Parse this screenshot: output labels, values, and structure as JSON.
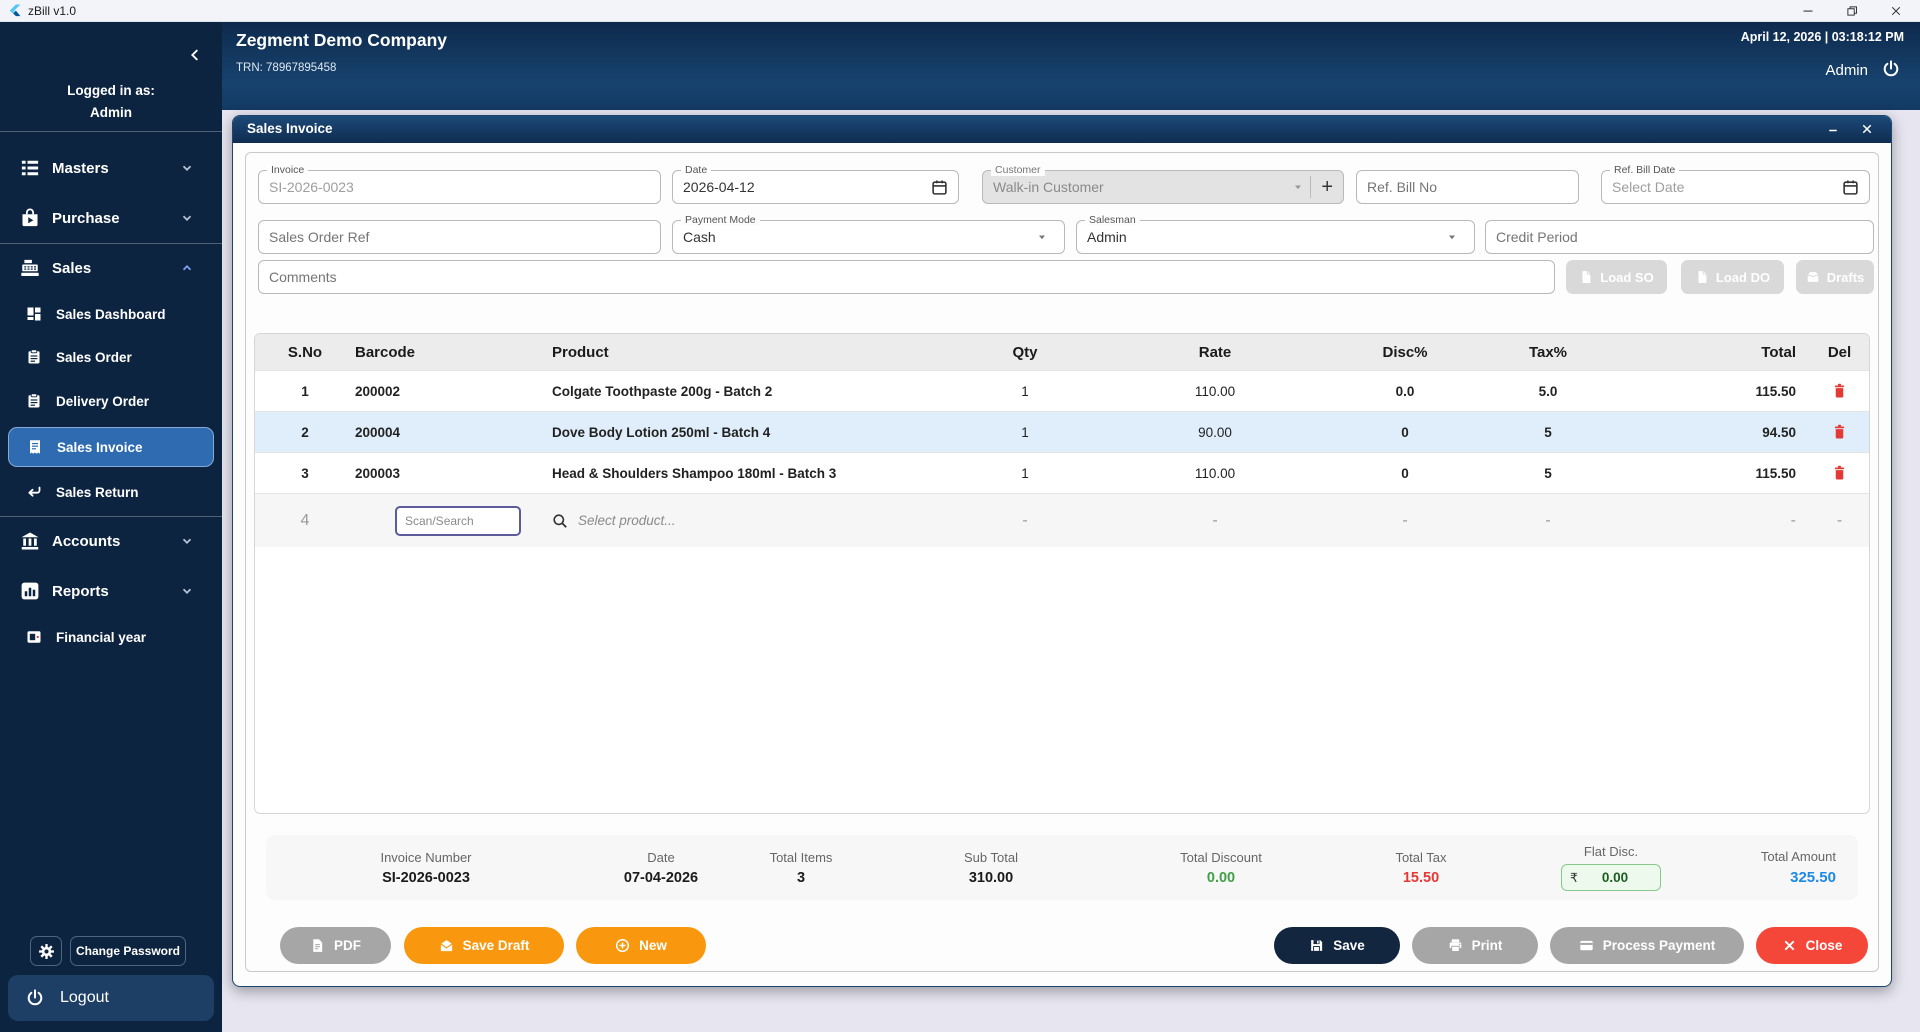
{
  "titlebar": {
    "app_title": "zBill v1.0"
  },
  "header": {
    "company": "Zegment Demo Company",
    "trn": "TRN: 78967895458",
    "datetime": "April 12, 2026 | 03:18:12 PM",
    "user": "Admin"
  },
  "sidebar": {
    "logged_in_label": "Logged in as:",
    "logged_in_user": "Admin",
    "menu": {
      "masters": "Masters",
      "purchase": "Purchase",
      "sales": "Sales",
      "sales_dashboard": "Sales Dashboard",
      "sales_order": "Sales Order",
      "delivery_order": "Delivery Order",
      "sales_invoice": "Sales Invoice",
      "sales_return": "Sales Return",
      "accounts": "Accounts",
      "reports": "Reports",
      "financial_year": "Financial year"
    },
    "change_password": "Change Password",
    "logout": "Logout"
  },
  "invoice_window": {
    "title": "Sales Invoice",
    "fields": {
      "invoice": {
        "label": "Invoice",
        "value": "SI-2026-0023"
      },
      "date": {
        "label": "Date",
        "value": "2026-04-12"
      },
      "customer": {
        "label": "Customer",
        "value": "Walk-in Customer",
        "add_symbol": "+"
      },
      "ref_bill_no": {
        "placeholder": "Ref. Bill No"
      },
      "ref_bill_date": {
        "label": "Ref. Bill Date",
        "placeholder": "Select Date"
      },
      "sales_order_ref": {
        "placeholder": "Sales Order Ref"
      },
      "payment_mode": {
        "label": "Payment Mode",
        "value": "Cash"
      },
      "salesman": {
        "label": "Salesman",
        "value": "Admin"
      },
      "credit_period": {
        "placeholder": "Credit Period"
      },
      "comments": {
        "placeholder": "Comments"
      }
    },
    "actions": {
      "load_so": "Load SO",
      "load_do": "Load DO",
      "drafts": "Drafts"
    },
    "table": {
      "headers": [
        "S.No",
        "Barcode",
        "Product",
        "Qty",
        "Rate",
        "Disc%",
        "Tax%",
        "Total",
        "Del"
      ],
      "rows": [
        {
          "sno": "1",
          "barcode": "200002",
          "product": "Colgate Toothpaste 200g - Batch 2",
          "qty": "1",
          "rate": "110.00",
          "disc": "0.0",
          "tax": "5.0",
          "total": "115.50"
        },
        {
          "sno": "2",
          "barcode": "200004",
          "product": "Dove Body Lotion 250ml - Batch 4",
          "qty": "1",
          "rate": "90.00",
          "disc": "0",
          "tax": "5",
          "total": "94.50"
        },
        {
          "sno": "3",
          "barcode": "200003",
          "product": "Head & Shoulders Shampoo 180ml - Batch 3",
          "qty": "1",
          "rate": "110.00",
          "disc": "0",
          "tax": "5",
          "total": "115.50"
        }
      ],
      "entry_row": {
        "sno": "4",
        "scan_placeholder": "Scan/Search",
        "select_placeholder": "Select product...",
        "empty": "-"
      }
    },
    "summary": {
      "invoice_number": {
        "label": "Invoice Number",
        "value": "SI-2026-0023"
      },
      "date": {
        "label": "Date",
        "value": "07-04-2026"
      },
      "total_items": {
        "label": "Total Items",
        "value": "3"
      },
      "sub_total": {
        "label": "Sub Total",
        "value": "310.00"
      },
      "total_discount": {
        "label": "Total Discount",
        "value": "0.00"
      },
      "total_tax": {
        "label": "Total Tax",
        "value": "15.50"
      },
      "flat_disc": {
        "label": "Flat Disc.",
        "currency": "₹",
        "value": "0.00"
      },
      "total_amount": {
        "label": "Total Amount",
        "value": "325.50"
      }
    },
    "buttons": {
      "pdf": "PDF",
      "save_draft": "Save Draft",
      "new": "New",
      "save": "Save",
      "print": "Print",
      "process_payment": "Process Payment",
      "close": "Close"
    }
  },
  "icons": {
    "titlebar": [
      "flutter-logo",
      "minimize-icon",
      "restore-icon",
      "close-icon"
    ],
    "header": [
      "power-icon"
    ],
    "sidebar": [
      "chevron-left-icon",
      "list-icon",
      "purchase-bag-icon",
      "cash-register-icon",
      "dashboard-icon",
      "clipboard-icon",
      "receipt-icon",
      "return-arrow-icon",
      "bank-icon",
      "bar-chart-icon",
      "calendar-card-icon",
      "gear-icon",
      "power-icon"
    ],
    "form": [
      "calendar-icon",
      "dropdown-arrow-icon",
      "plus-icon",
      "document-icon",
      "drafts-box-icon",
      "search-icon",
      "trash-icon"
    ],
    "buttons": [
      "pdf-icon",
      "envelope-icon",
      "plus-circle-icon",
      "floppy-icon",
      "printer-icon",
      "card-icon",
      "x-icon"
    ]
  },
  "colors": {
    "sidebar_bg": "#0d2440",
    "header_gradient_top": "#0e2a4d",
    "active_item": "#2e6bb0",
    "accent_orange": "#f9980f",
    "save_navy": "#13263f",
    "close_red": "#f4473a",
    "row_highlight": "#dfeefa",
    "discount_green": "#43a047",
    "tax_red": "#e53935",
    "amount_blue": "#1e88e5"
  }
}
